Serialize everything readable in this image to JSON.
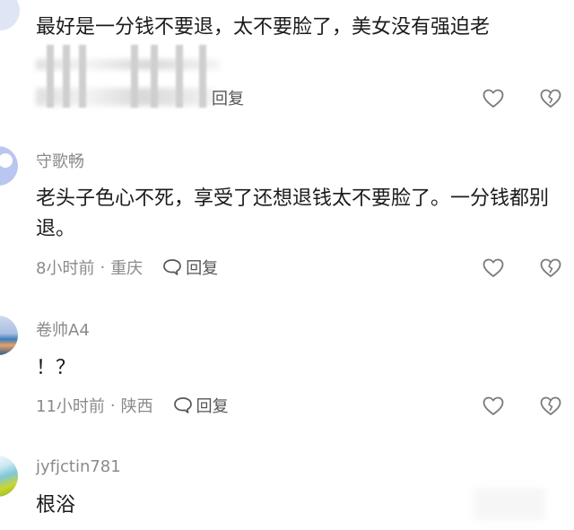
{
  "comments": [
    {
      "text": "最好是一分钱不要退，太不要脸了，美女没有强迫老",
      "reply_label": "回复"
    },
    {
      "username": "守歌畅",
      "text": "老头子色心不死，享受了还想退钱太不要脸了。一分钱都别退。",
      "time": "8小时前",
      "location": "重庆",
      "reply_label": "回复"
    },
    {
      "username": "卷帅A4",
      "text": "！？",
      "time": "11小时前",
      "location": "陕西",
      "reply_label": "回复"
    },
    {
      "username": "jyfjctin781",
      "text": "根浴"
    }
  ],
  "separator": "·",
  "icons": {
    "like": "heart-icon",
    "dislike": "broken-heart-icon",
    "reply": "speech-bubble-icon"
  },
  "colors": {
    "text": "#1b1b1b",
    "meta": "#8a8a8a",
    "icon": "#7a7a7a",
    "avatar1": "#b9c6f0",
    "avatar3": "#3a7fb8"
  }
}
